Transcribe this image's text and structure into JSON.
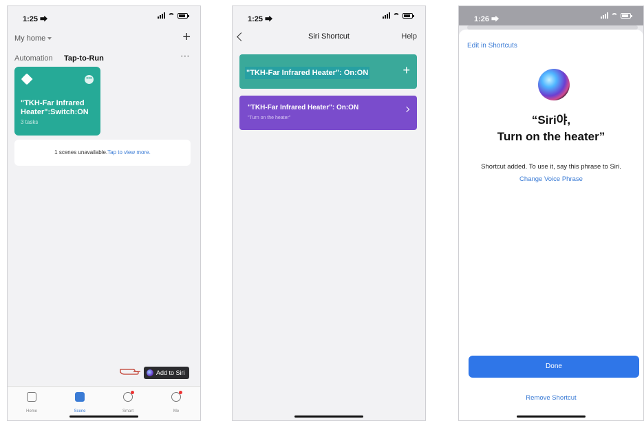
{
  "phone1": {
    "status": {
      "time": "1:25 ⮕"
    },
    "header": {
      "home_label": "My home",
      "add": "+"
    },
    "tabs": {
      "automation": "Automation",
      "tap_to_run": "Tap-to-Run",
      "more": "⋯"
    },
    "scene_card": {
      "name": "\"TKH-Far Infrared Heater\":Switch:ON",
      "tasks": "3 tasks",
      "menu": "•••"
    },
    "unavailable": {
      "text": "1 scenes unavailable.",
      "link": "Tap to view more."
    },
    "add_to_siri": "Add to Siri",
    "tabbar": [
      {
        "label": "Home"
      },
      {
        "label": "Scene"
      },
      {
        "label": "Smart"
      },
      {
        "label": "Me"
      }
    ],
    "colors": {
      "card": "#26aa97",
      "accent": "#3a7bd5"
    }
  },
  "phone2": {
    "status": {
      "time": "1:25 ⮕"
    },
    "nav": {
      "title": "Siri Shortcut",
      "help": "Help"
    },
    "teal_card": {
      "text": "\"TKH-Far Infrared Heater\": On:ON",
      "add": "+"
    },
    "purple_card": {
      "title": "\"TKH-Far Infrared Heater\": On:ON",
      "phrase": "\"Turn on the heater\""
    },
    "colors": {
      "teal": "#3aa99a",
      "purple": "#7a4ccc"
    }
  },
  "phone3": {
    "status": {
      "time": "1:26 ⮕"
    },
    "edit_link": "Edit in Shortcuts",
    "phrase_line1": "“Siri야,",
    "phrase_line2": "Turn on the heater”",
    "added_text": "Shortcut added. To use it, say this phrase to Siri.",
    "change_link": "Change Voice Phrase",
    "done_button": "Done",
    "remove_link": "Remove Shortcut",
    "colors": {
      "button": "#2f76e8"
    }
  }
}
